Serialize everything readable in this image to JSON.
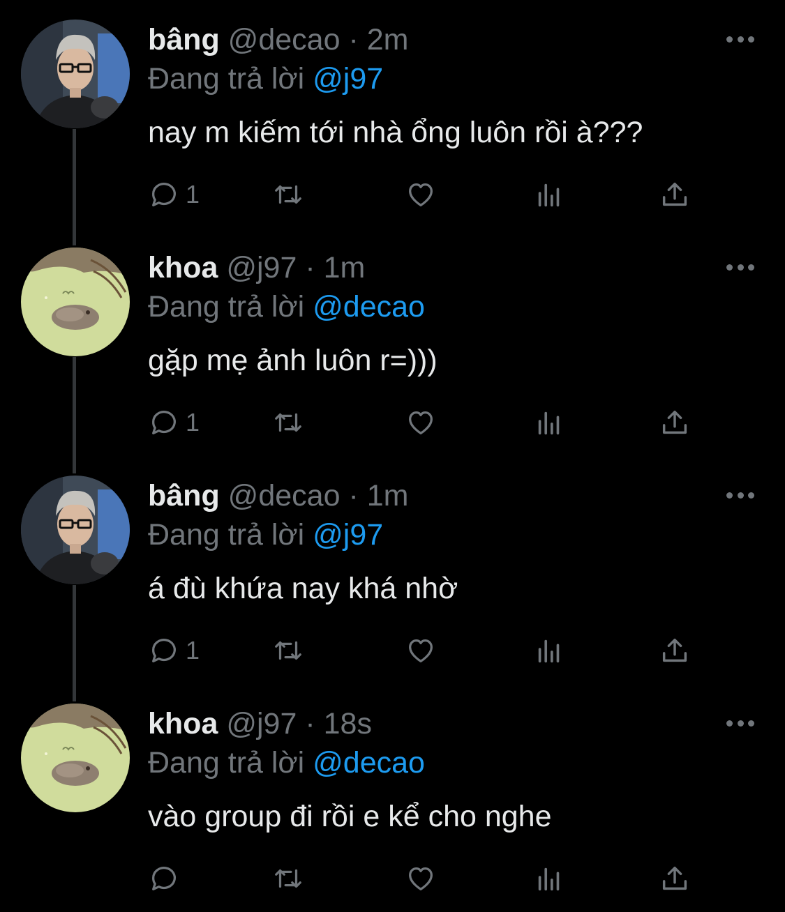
{
  "thread": [
    {
      "display_name": "bâng",
      "handle": "@decao",
      "separator": "·",
      "time": "2m",
      "replying_label": "Đang trả lời",
      "replying_to": "@j97",
      "text": "nay m kiếm tới nhà ổng luôn rồi à???",
      "reply_count": "1",
      "avatar": "decao-avatar"
    },
    {
      "display_name": "khoa",
      "handle": "@j97",
      "separator": "·",
      "time": "1m",
      "replying_label": "Đang trả lời",
      "replying_to": "@decao",
      "text": "gặp mẹ ảnh luôn r=)))",
      "reply_count": "1",
      "avatar": "j97-avatar"
    },
    {
      "display_name": "bâng",
      "handle": "@decao",
      "separator": "·",
      "time": "1m",
      "replying_label": "Đang trả lời",
      "replying_to": "@j97",
      "text": "á đù khứa nay khá nhờ",
      "reply_count": "1",
      "avatar": "decao-avatar"
    },
    {
      "display_name": "khoa",
      "handle": "@j97",
      "separator": "·",
      "time": "18s",
      "replying_label": "Đang trả lời",
      "replying_to": "@decao",
      "text": "vào group đi rồi e kể cho nghe",
      "reply_count": "",
      "avatar": "j97-avatar"
    }
  ],
  "icons": {
    "reply": "reply-icon",
    "retweet": "retweet-icon",
    "like": "heart-icon",
    "views": "views-icon",
    "share": "share-icon",
    "more": "more-icon"
  },
  "colors": {
    "background": "#000000",
    "primary_text": "#e7e9ea",
    "secondary_text": "#71767b",
    "mention": "#1d9bf0",
    "thread_line": "#333639"
  }
}
